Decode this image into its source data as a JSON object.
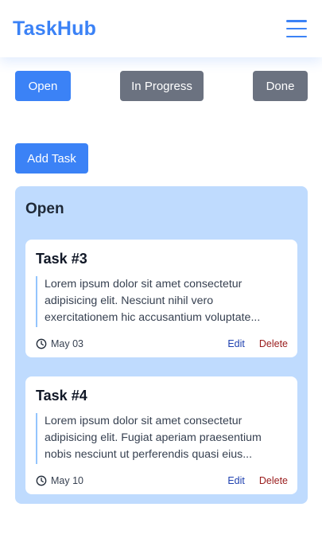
{
  "app": {
    "title": "TaskHub"
  },
  "header": {
    "menu_icon": "hamburger-menu-icon"
  },
  "filters": [
    {
      "label": "Open",
      "active": true,
      "color": "#3b82f6"
    },
    {
      "label": "In Progress",
      "active": false,
      "color": "#6b7280"
    },
    {
      "label": "Done",
      "active": false,
      "color": "#6b7280"
    }
  ],
  "add_task": {
    "label": "Add Task"
  },
  "column": {
    "title": "Open",
    "background": "#bfdbfe",
    "cards": [
      {
        "title": "Task #3",
        "description": "Lorem ipsum dolor sit amet consectetur adipisicing elit. Nesciunt nihil vero exercitationem hic accusantium voluptate...",
        "date": "May 03",
        "edit_label": "Edit",
        "delete_label": "Delete"
      },
      {
        "title": "Task #4",
        "description": "Lorem ipsum dolor sit amet consectetur adipisicing elit. Fugiat aperiam praesentium nobis nesciunt ut perferendis quasi eius...",
        "date": "May 10",
        "edit_label": "Edit",
        "delete_label": "Delete"
      }
    ]
  },
  "colors": {
    "brand": "#3b82f6",
    "button_gray": "#6b7280",
    "edit_link": "#1e40af",
    "delete_link": "#991b1b"
  }
}
